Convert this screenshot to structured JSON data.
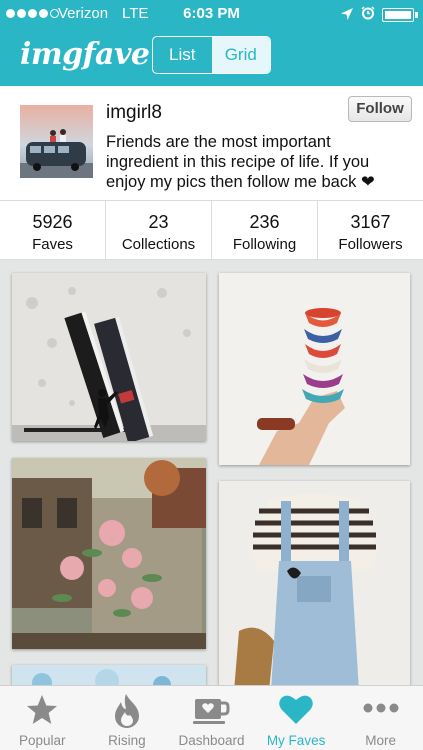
{
  "status_bar": {
    "carrier": "Verizon",
    "network": "LTE",
    "time": "6:03 PM",
    "signal_bars_filled": 4,
    "signal_bars_total": 5,
    "icons": [
      "location-icon",
      "alarm-icon",
      "battery-icon"
    ]
  },
  "header": {
    "logo": "imgfave",
    "view_toggle": {
      "options": [
        "List",
        "Grid"
      ],
      "selected": "Grid"
    }
  },
  "profile": {
    "username": "imgirl8",
    "follow_label": "Follow",
    "bio": "Friends are the most important ingredient in this recipe of life. If you enjoy my pics then follow me back ❤"
  },
  "stats": [
    {
      "value": "5926",
      "label": "Faves"
    },
    {
      "value": "23",
      "label": "Collections"
    },
    {
      "value": "236",
      "label": "Following"
    },
    {
      "value": "3167",
      "label": "Followers"
    }
  ],
  "tabs": [
    {
      "label": "Popular",
      "icon": "star-icon"
    },
    {
      "label": "Rising",
      "icon": "flame-icon"
    },
    {
      "label": "Dashboard",
      "icon": "mug-heart-icon"
    },
    {
      "label": "My Faves",
      "icon": "heart-icon",
      "active": true
    },
    {
      "label": "More",
      "icon": "more-dots-icon"
    }
  ],
  "colors": {
    "accent": "#2bb6c6",
    "tab_inactive": "#8a8a8a",
    "toggle_active_bg": "#e5f7fa"
  }
}
